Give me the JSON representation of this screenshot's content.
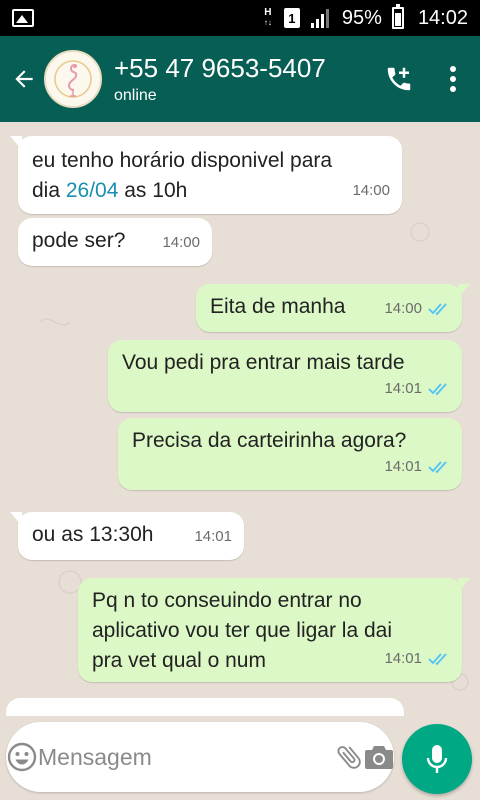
{
  "status_bar": {
    "ht_top": "H",
    "ht_bottom": "↑↓",
    "sim": "1",
    "battery": "95%",
    "time": "14:02"
  },
  "header": {
    "contact_name": "+55 47 9653-5407",
    "contact_status": "online"
  },
  "messages": [
    {
      "direction": "in",
      "line1": "eu tenho horário disponivel para",
      "pre": "dia ",
      "link": "26/04",
      "post": " as 10h",
      "time": "14:00"
    },
    {
      "direction": "in",
      "text": "pode ser?",
      "time": "14:00"
    },
    {
      "direction": "out",
      "text": "Eita de manha",
      "time": "14:00",
      "status": "read"
    },
    {
      "direction": "out",
      "text": "Vou pedi pra entrar mais tarde",
      "time": "14:01",
      "status": "read"
    },
    {
      "direction": "out",
      "text": "Precisa da carteirinha agora?",
      "time": "14:01",
      "status": "read"
    },
    {
      "direction": "in",
      "text": "ou as 13:30h",
      "time": "14:01"
    },
    {
      "direction": "out",
      "lines": [
        "Pq n to conseuindo entrar no",
        "aplicativo vou ter que ligar la dai",
        "pra vet qual o num"
      ],
      "time": "14:01",
      "status": "read"
    }
  ],
  "input": {
    "placeholder": "Mensagem"
  },
  "colors": {
    "header": "#075e54",
    "outgoing_bubble": "#dcf8c6",
    "incoming_bubble": "#ffffff",
    "read_ticks": "#4fc3f7",
    "mic_button": "#00a884",
    "chat_background": "#e7dfd6"
  },
  "icons": [
    "gallery-icon",
    "signal-icon",
    "battery-icon",
    "back-arrow-icon",
    "add-call-icon",
    "more-vert-icon",
    "double-check-icon",
    "emoji-icon",
    "paperclip-icon",
    "camera-icon",
    "mic-icon"
  ]
}
